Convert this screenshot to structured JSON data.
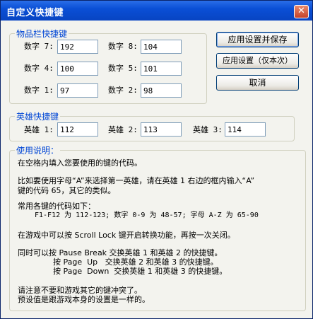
{
  "window": {
    "title": "自定义快捷键",
    "close_symbol": "✕"
  },
  "buttons": {
    "apply_save": "应用设置并保存",
    "apply_once": "应用设置（仅本次）",
    "cancel": "取消"
  },
  "item_hotkeys": {
    "title": "物品栏快捷键",
    "fields": [
      {
        "label": "数字 7:",
        "value": "192"
      },
      {
        "label": "数字 8:",
        "value": "104"
      },
      {
        "label": "数字 4:",
        "value": "100"
      },
      {
        "label": "数字 5:",
        "value": "101"
      },
      {
        "label": "数字 1:",
        "value": "97"
      },
      {
        "label": "数字 2:",
        "value": "98"
      }
    ]
  },
  "hero_hotkeys": {
    "title": "英雄快捷键",
    "fields": [
      {
        "label": "英雄 1:",
        "value": "112"
      },
      {
        "label": "英雄 2:",
        "value": "113"
      },
      {
        "label": "英雄 3:",
        "value": "114"
      }
    ]
  },
  "instructions": {
    "title": "使用说明：",
    "line1": "在空格内填入您要使用的键的代码。",
    "line2": "比如要使用字母“A”来选择第一英雄，请在英雄 1 右边的框内输入“A”",
    "line3": "键的代码 65，其它的类似。",
    "line4": "常用各键的代码如下：",
    "line5": "F1-F12 为 112-123; 数字 0-9 为 48-57; 字母 A-Z 为 65-90",
    "line6": "在游戏中可以按 Scroll Lock 键开启转换功能，再按一次关闭。",
    "line7": "同时可以按 Pause Break 交换英雄 1 和英雄 2 的快捷键。",
    "line8": "按 Page  Up   交换英雄 2 和英雄 3 的快捷键。",
    "line9": "按 Page  Down  交换英雄 1 和英雄 3 的快捷键。",
    "line10": "请注意不要和游戏其它的键冲突了。",
    "line11": "预设值是跟游戏本身的设置是一样的。"
  }
}
